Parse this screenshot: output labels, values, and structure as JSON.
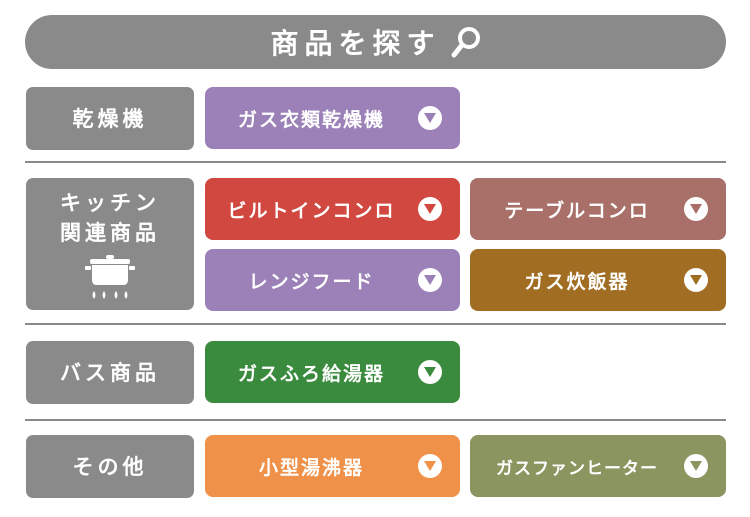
{
  "header": {
    "title": "商品を探す",
    "icon": "search-icon",
    "color": "#8a8a8a"
  },
  "categories": [
    {
      "label": "乾燥機"
    },
    {
      "label_line1": "キッチン",
      "label_line2": "関連商品",
      "icon": "pot-on-stove-icon"
    },
    {
      "label": "バス商品"
    },
    {
      "label": "その他"
    }
  ],
  "buttons": {
    "gas_dryer": {
      "label": "ガス衣類乾燥機",
      "color": "#9c80b8"
    },
    "builtin_stove": {
      "label": "ビルトインコンロ",
      "color": "#d0483f"
    },
    "table_stove": {
      "label": "テーブルコンロ",
      "color": "#a87068"
    },
    "range_hood": {
      "label": "レンジフード",
      "color": "#9c80b8"
    },
    "gas_rice_cooker": {
      "label": "ガス炊飯器",
      "color": "#a06d22"
    },
    "bath_water": {
      "label": "ガスふろ給湯器",
      "color": "#3a8b3d"
    },
    "small_water": {
      "label": "小型湯沸器",
      "color": "#f0914a"
    },
    "fan_heater": {
      "label": "ガスファンヒーター",
      "color": "#8b9560"
    }
  },
  "chevron_icon": "chevron-down-icon"
}
